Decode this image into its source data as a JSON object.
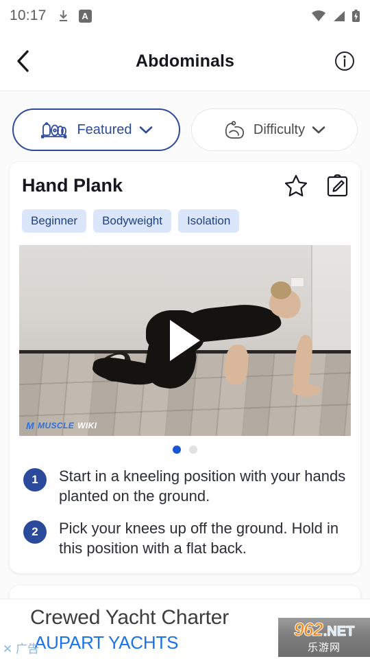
{
  "statusbar": {
    "time": "10:17",
    "left_icons": [
      {
        "name": "download-icon"
      },
      {
        "name": "keyboard-language-icon",
        "label": "A"
      }
    ],
    "right_icons": [
      {
        "name": "wifi-icon"
      },
      {
        "name": "cellular-signal-icon"
      },
      {
        "name": "battery-charging-icon"
      }
    ]
  },
  "header": {
    "back_label": "Back",
    "title": "Abdominals",
    "info_label": "Info"
  },
  "filters": [
    {
      "label": "Featured",
      "icon": "gym-equipment-icon",
      "active": true
    },
    {
      "label": "Difficulty",
      "icon": "bicep-flex-icon",
      "active": false
    }
  ],
  "exercise": {
    "title": "Hand Plank",
    "favorite_label": "Favorite",
    "log_label": "Log workout",
    "tags": [
      "Beginner",
      "Bodyweight",
      "Isolation"
    ],
    "video": {
      "play_label": "Play",
      "watermark_mark": "M",
      "watermark_primary": "MUSCLE",
      "watermark_secondary": "WIKI"
    },
    "carousel": {
      "total": 2,
      "active_index": 0
    },
    "steps": [
      {
        "num": "1",
        "text": "Start in a kneeling position with your hands planted on the ground."
      },
      {
        "num": "2",
        "text": "Pick your knees up off the ground. Hold in this position with a flat back."
      }
    ]
  },
  "ad": {
    "title": "Crewed Yacht Charter",
    "brand": "AUPART YACHTS",
    "close_label": "✕ 广告",
    "watermark_number": "962",
    "watermark_net": ".NET",
    "watermark_cn": "乐游网"
  },
  "colors": {
    "accent_blue": "#2c4a9a",
    "tag_bg": "#dbe6fa",
    "tag_text": "#20407e",
    "step_badge": "#2b4a9b",
    "dot_active": "#1956d6",
    "ad_link": "#1a73e8"
  }
}
